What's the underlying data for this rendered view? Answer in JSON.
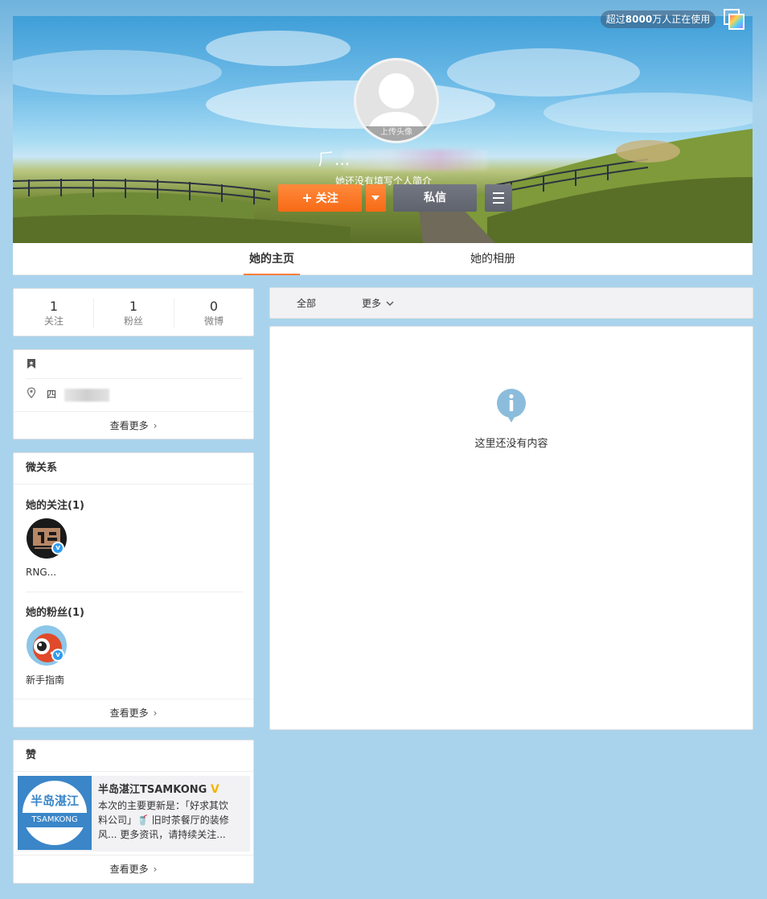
{
  "header": {
    "usage_badge_prefix": "超过",
    "usage_badge_count": "8000",
    "usage_badge_suffix": "万人正在使用",
    "skin_icon": "skin-palette-icon"
  },
  "profile": {
    "avatar_upload_label": "上传头像",
    "nickname_visible": "𠂆...",
    "intro": "她还没有填写个人简介",
    "follow_label": "关注",
    "message_label": "私信"
  },
  "tabs": [
    {
      "label": "她的主页",
      "active": true
    },
    {
      "label": "她的相册",
      "active": false
    }
  ],
  "counts": [
    {
      "num": "1",
      "label": "关注"
    },
    {
      "num": "1",
      "label": "粉丝"
    },
    {
      "num": "0",
      "label": "微博"
    }
  ],
  "info": {
    "location_visible": "四",
    "more_label": "查看更多"
  },
  "relations": {
    "title": "微关系",
    "following_title": "她的关注(1)",
    "following": [
      {
        "name": "RNG..."
      }
    ],
    "fans_title": "她的粉丝(1)",
    "fans": [
      {
        "name": "新手指南"
      }
    ],
    "more_label": "查看更多"
  },
  "likes": {
    "title": "赞",
    "item": {
      "name": "半岛湛江TSAMKONG",
      "thumb_title": "半岛湛江",
      "thumb_sub": "TSAMKONG",
      "desc_line1": "本次的主要更新是：「好求其饮",
      "desc_line2": "料公司」🥤 旧时茶餐厅的装修",
      "desc_line3": "风... 更多资讯，请持续关注..."
    },
    "more_label": "查看更多"
  },
  "feed": {
    "filter_all": "全部",
    "filter_more": "更多",
    "empty_text": "这里还没有内容"
  },
  "colors": {
    "accent_orange": "#f76a16",
    "verified_blue": "#2f9cf0",
    "verified_gold": "#f5b400",
    "page_bg": "#a9d3ec"
  }
}
